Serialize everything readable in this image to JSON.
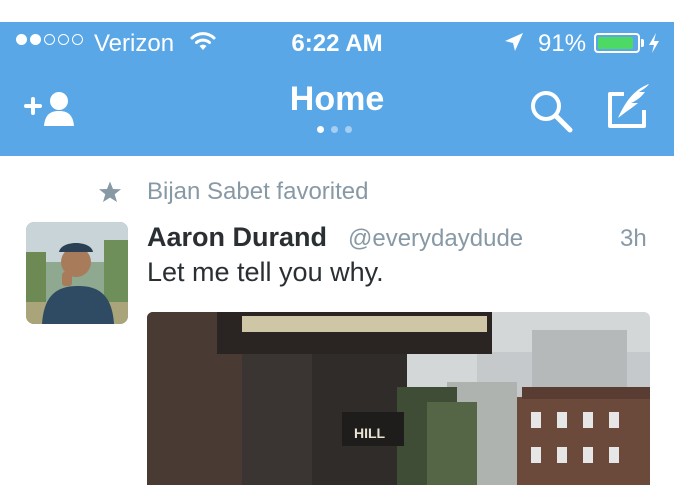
{
  "status_bar": {
    "carrier": "Verizon",
    "signal_dots_filled": 2,
    "signal_dots_total": 5,
    "time": "6:22 AM",
    "battery_percent": "91%",
    "battery_level": 0.91,
    "icons": [
      "wifi-icon",
      "location-arrow-icon",
      "battery-icon",
      "charging-bolt-icon"
    ]
  },
  "nav": {
    "title": "Home",
    "page_indicator": {
      "count": 3,
      "active": 0
    },
    "icons": [
      "add-follow-icon",
      "search-icon",
      "compose-tweet-icon"
    ]
  },
  "tweet": {
    "context_text": "Bijan Sabet favorited",
    "context_icon": "star-icon",
    "author_name": "Aaron Durand",
    "author_handle": "@everydaydude",
    "time_ago": "3h",
    "text": "Let me tell you why.",
    "sign_text": "HILL"
  },
  "colors": {
    "brand_blue": "#5aa7e8",
    "battery_green": "#4cd964",
    "text_dark": "#292f33",
    "text_gray": "#8899a6"
  }
}
